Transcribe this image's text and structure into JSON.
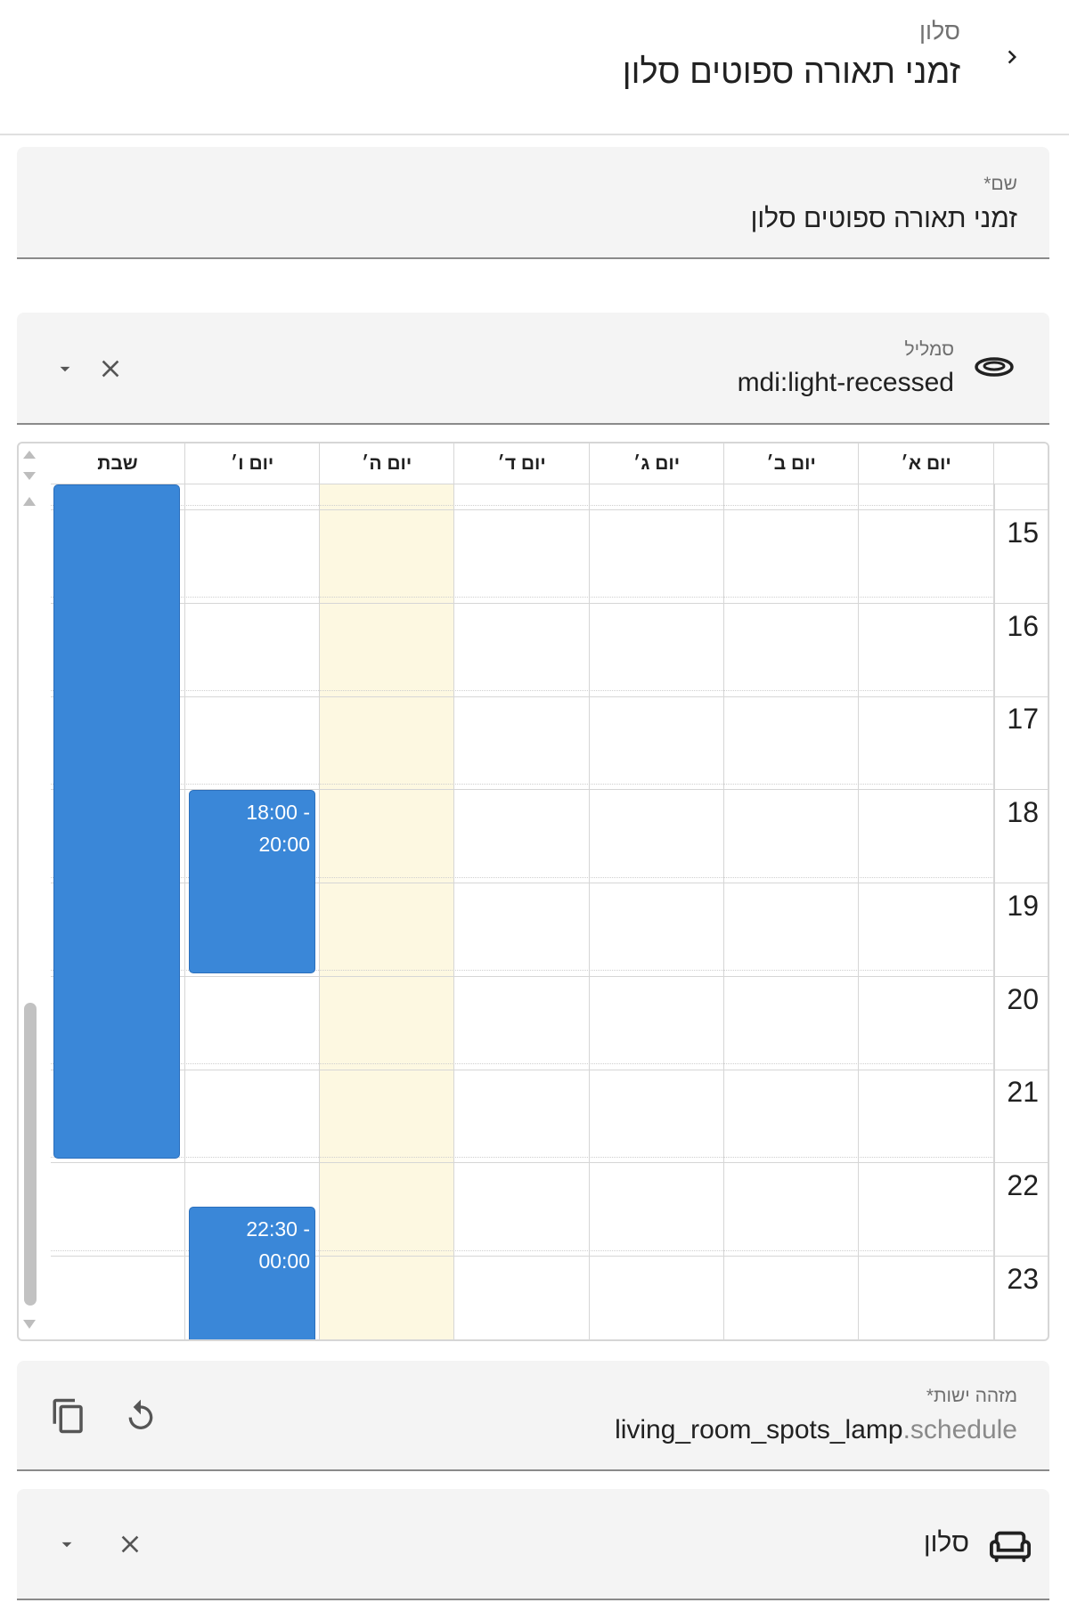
{
  "header": {
    "subtitle": "סלון",
    "title": "זמני תאורה ספוטים סלון"
  },
  "name_field": {
    "label": "שם*",
    "value": "זמני תאורה ספוטים סלון"
  },
  "icon_field": {
    "label": "סמליל",
    "value": "mdi:light-recessed",
    "icon": "light-recessed-icon"
  },
  "scheduler": {
    "days": [
      "יום א׳",
      "יום ב׳",
      "יום ג׳",
      "יום ד׳",
      "יום ה׳",
      "יום ו׳",
      "שבת"
    ],
    "today_color": "#fdf8e1",
    "event_color": "#3a87d8",
    "hours": [
      "15",
      "16",
      "17",
      "18",
      "19",
      "20",
      "21",
      "22",
      "23"
    ],
    "events": [
      {
        "day": "יום ו׳",
        "line1": "18:00 -",
        "line2": "20:00"
      },
      {
        "day": "יום ו׳",
        "line1": "22:30 -",
        "line2": "00:00"
      },
      {
        "day": "שבת",
        "line1": "",
        "line2": ""
      }
    ]
  },
  "entity_field": {
    "label": "מזהה ישות*",
    "value_main": "living_room_spots_lamp",
    "value_suffix": ".schedule"
  },
  "area_field": {
    "value": "סלון",
    "icon": "sofa-icon"
  }
}
